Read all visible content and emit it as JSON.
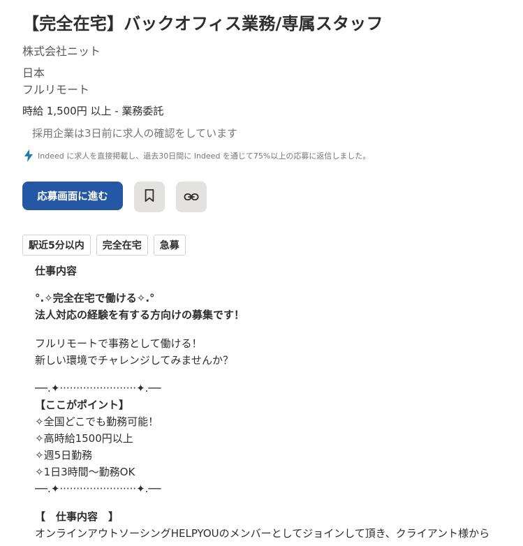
{
  "job": {
    "title": "【完全在宅】バックオフィス業務/専属スタッフ",
    "company": "株式会社ニット",
    "location_country": "日本",
    "location_type": "フルリモート",
    "salary": "時給 1,500円 以上  - 業務委託",
    "employer_status": "採用企業は3日前に求人の確認をしています",
    "response_note": "Indeed に求人を直接掲載し、過去30日間に Indeed を通じて75%以上の応募に返信しました。"
  },
  "actions": {
    "apply_label": "応募画面に進む",
    "save_icon": "bookmark-icon",
    "copy_icon": "link-icon"
  },
  "tags": [
    "駅近5分以内",
    "完全在宅",
    "急募"
  ],
  "description": {
    "heading": "仕事内容",
    "lead1": "°.✧完全在宅で働ける✧.°",
    "lead2": "法人対応の経験を有する方向けの募集です！",
    "p1": "フルリモートで事務として働ける！",
    "p2": "新しい環境でチャレンジしてみませんか？",
    "divider1": "──.✦·······················✦.──",
    "point_heading": "【ここがポイント】",
    "points": [
      "✧全国どこでも勤務可能！",
      "✧高時給1500円以上",
      "✧週5日勤務",
      "✧1日3時間〜勤務OK"
    ],
    "divider2": "──.✦·······················✦.──",
    "section_heading": "【　仕事内容　】",
    "section_text": "オンラインアウトソーシングHELPYOUのメンバーとしてジョインして頂き、クライアント様から"
  },
  "colors": {
    "primary": "#2557a7",
    "icon_button_bg": "#e4e2e0",
    "bolt": "#1a7fb0"
  }
}
